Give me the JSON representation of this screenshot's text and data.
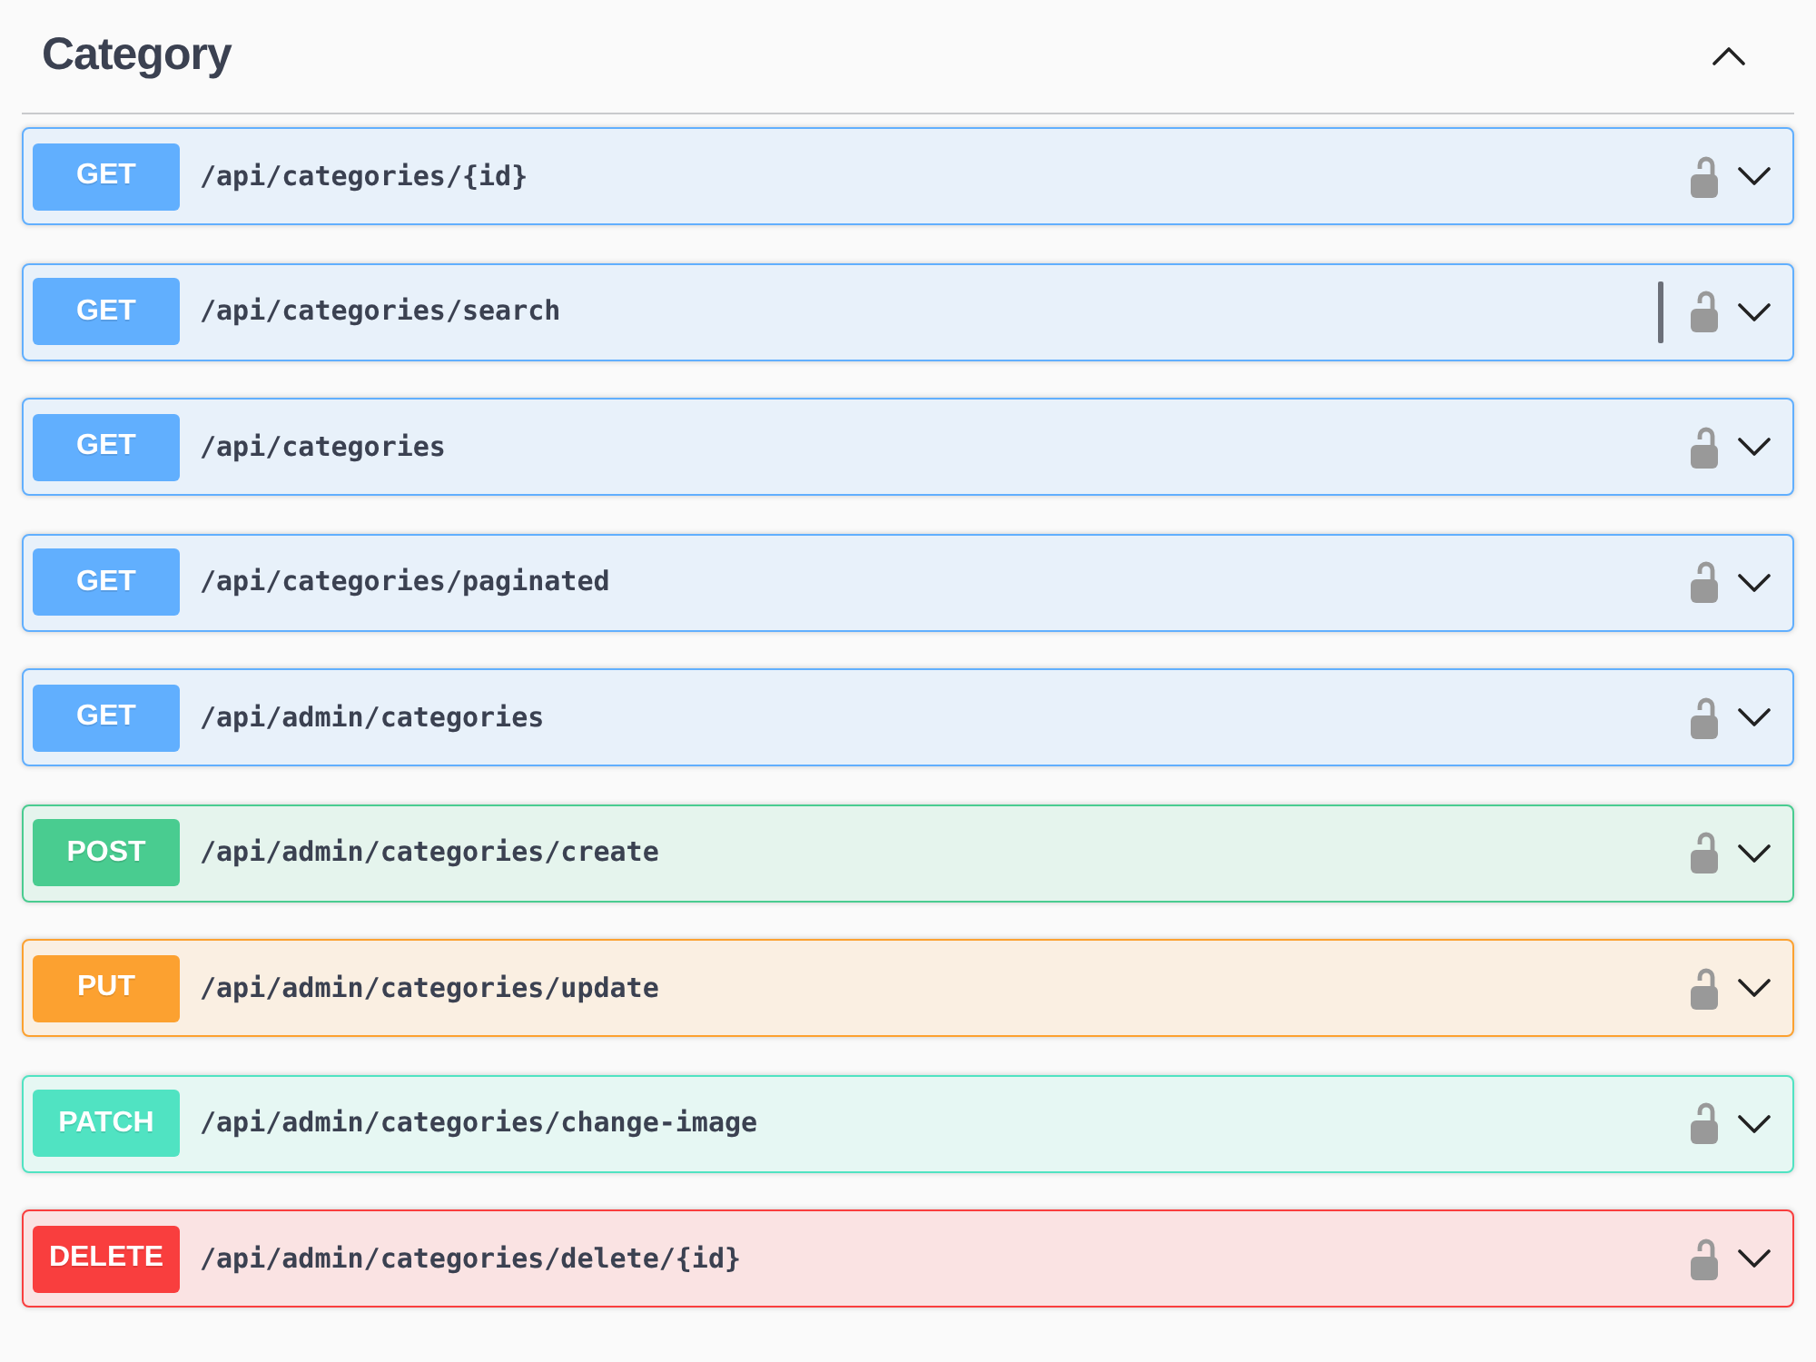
{
  "section": {
    "title": "Category",
    "expanded": true
  },
  "operations": [
    {
      "method": "GET",
      "path": "/api/categories/{id}",
      "color": "#61affe",
      "locked": false,
      "expanded": false,
      "cursor": false
    },
    {
      "method": "GET",
      "path": "/api/categories/search",
      "color": "#61affe",
      "locked": false,
      "expanded": false,
      "cursor": true
    },
    {
      "method": "GET",
      "path": "/api/categories",
      "color": "#61affe",
      "locked": false,
      "expanded": false,
      "cursor": false
    },
    {
      "method": "GET",
      "path": "/api/categories/paginated",
      "color": "#61affe",
      "locked": false,
      "expanded": false,
      "cursor": false
    },
    {
      "method": "GET",
      "path": "/api/admin/categories",
      "color": "#61affe",
      "locked": false,
      "expanded": false,
      "cursor": false
    },
    {
      "method": "POST",
      "path": "/api/admin/categories/create",
      "color": "#49cc90",
      "locked": false,
      "expanded": false,
      "cursor": false
    },
    {
      "method": "PUT",
      "path": "/api/admin/categories/update",
      "color": "#fca130",
      "locked": false,
      "expanded": false,
      "cursor": false
    },
    {
      "method": "PATCH",
      "path": "/api/admin/categories/change-image",
      "color": "#50e3c2",
      "locked": false,
      "expanded": false,
      "cursor": false
    },
    {
      "method": "DELETE",
      "path": "/api/admin/categories/delete/{id}",
      "color": "#f93e3e",
      "locked": false,
      "expanded": false,
      "cursor": false
    }
  ]
}
